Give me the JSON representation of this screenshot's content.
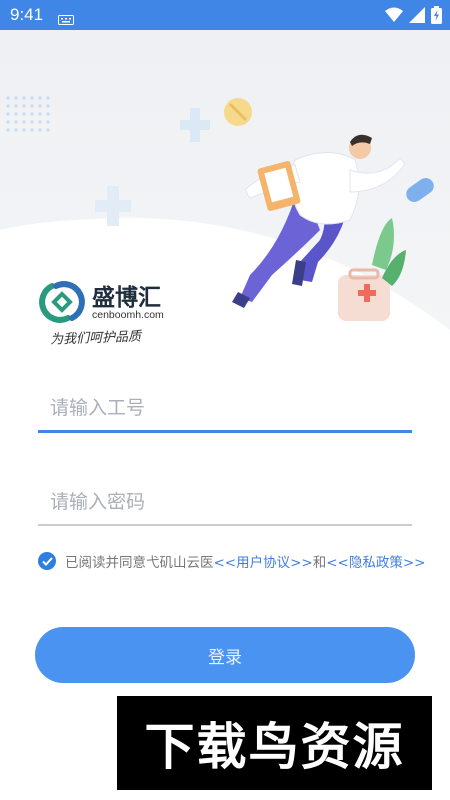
{
  "status_bar": {
    "time": "9:41"
  },
  "brand": {
    "name": "盛博汇",
    "domain": "cenboomh.com",
    "slogan": "为我们呵护品质"
  },
  "form": {
    "employee_id_placeholder": "请输入工号",
    "employee_id_value": "",
    "password_placeholder": "请输入密码",
    "password_value": ""
  },
  "agreement": {
    "checked": true,
    "prefix": "已阅读并同意弋矶山云医",
    "user_agreement_link": "<<用户协议>>",
    "and": "和",
    "privacy_policy_link": "<<隐私政策>>"
  },
  "login_button": {
    "label": "登录"
  },
  "watermark": {
    "text": "下载鸟资源"
  },
  "colors": {
    "primary": "#3f86e6",
    "button": "#4a93f0",
    "link": "#3f7fe0",
    "placeholder": "#aab0b8"
  }
}
